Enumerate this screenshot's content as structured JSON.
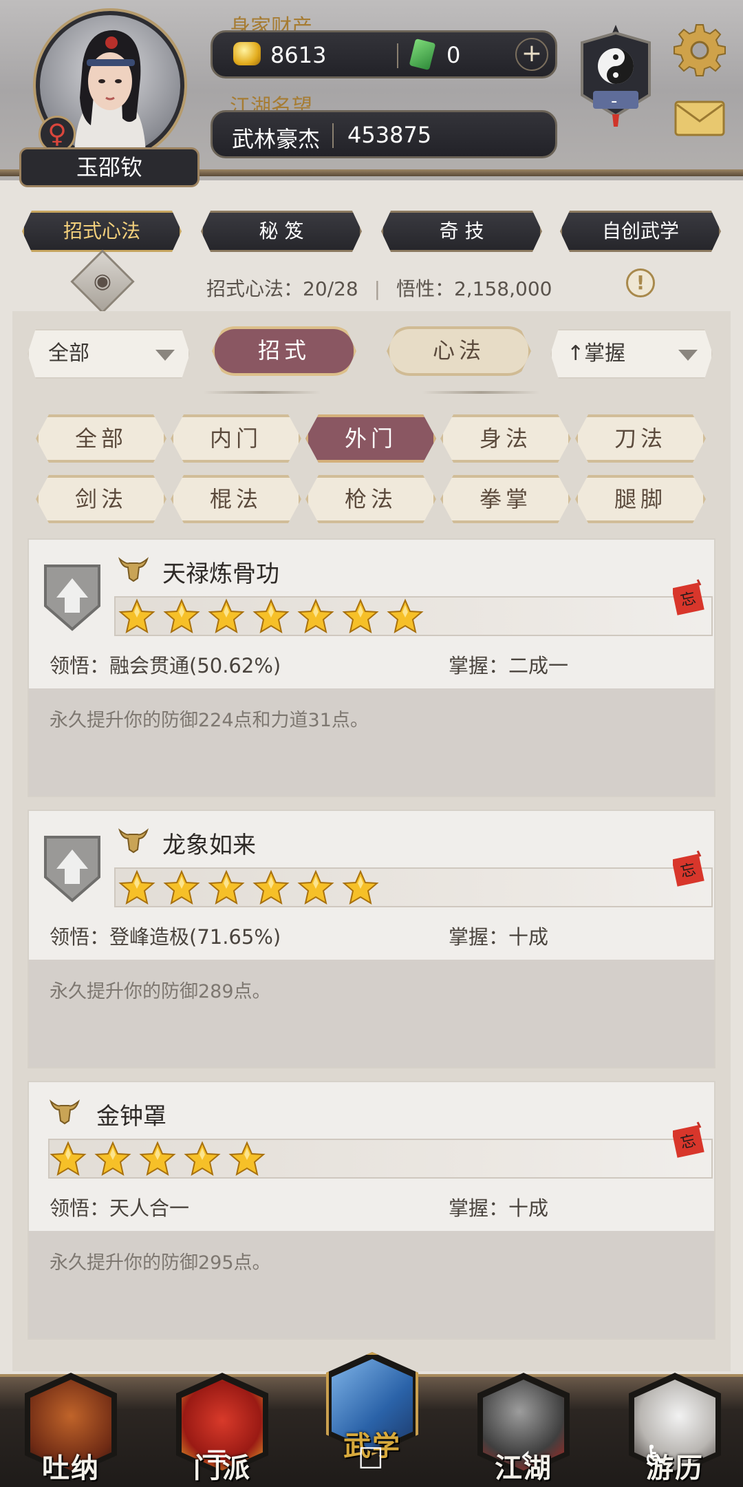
{
  "header": {
    "player_name": "玉邵钦",
    "gender_symbol": "♀",
    "wealth_label": "身家财产",
    "gold": "8613",
    "jade": "0",
    "add_symbol": "+",
    "reputation_label": "江湖名望",
    "reputation_title": "武林豪杰",
    "reputation_value": "453875",
    "faction_badge_text": "-",
    "icons": [
      "gear-icon",
      "mail-icon",
      "yin-yang-icon"
    ]
  },
  "top_tabs": [
    {
      "label": "招式心法",
      "active": true
    },
    {
      "label": "秘 笈",
      "active": false
    },
    {
      "label": "奇 技",
      "active": false
    },
    {
      "label": "自创武学",
      "active": false
    }
  ],
  "stats": {
    "moves": "招式心法：20/28",
    "comprehension": "悟性：2,158,000",
    "warn_symbol": "!"
  },
  "filters": {
    "left_dropdown": "全部",
    "right_dropdown": "掌握",
    "sort_arrow": "↑",
    "segments": [
      {
        "label": "招式",
        "active": true
      },
      {
        "label": "心法",
        "active": false
      }
    ]
  },
  "categories": [
    {
      "label": "全部",
      "active": false
    },
    {
      "label": "内门",
      "active": false
    },
    {
      "label": "外门",
      "active": true
    },
    {
      "label": "身法",
      "active": false
    },
    {
      "label": "刀法",
      "active": false
    },
    {
      "label": "剑法",
      "active": false
    },
    {
      "label": "棍法",
      "active": false
    },
    {
      "label": "枪法",
      "active": false
    },
    {
      "label": "拳掌",
      "active": false
    },
    {
      "label": "腿脚",
      "active": false
    }
  ],
  "skills": [
    {
      "name": "天禄炼骨功",
      "stars": 7,
      "has_upgrade_shield": true,
      "insight": "领悟：融会贯通(50.62%)",
      "mastery": "掌握：二成一",
      "description": "永久提升你的防御224点和力道31点。",
      "tag_text": "忘"
    },
    {
      "name": "龙象如来",
      "stars": 6,
      "has_upgrade_shield": true,
      "insight": "领悟：登峰造极(71.65%)",
      "mastery": "掌握：十成",
      "description": "永久提升你的防御289点。",
      "tag_text": "忘"
    },
    {
      "name": "金钟罩",
      "stars": 5,
      "has_upgrade_shield": false,
      "insight": "领悟：天人合一",
      "mastery": "掌握：十成",
      "description": "永久提升你的防御295点。",
      "tag_text": "忘"
    }
  ],
  "bottom_nav": [
    {
      "label": "吐纳",
      "active": false
    },
    {
      "label": "门派",
      "active": false
    },
    {
      "label": "武学",
      "active": true
    },
    {
      "label": "江湖",
      "active": false
    },
    {
      "label": "游历",
      "active": false
    }
  ],
  "system_nav": {
    "menu": "≡",
    "home": "□",
    "back": "‹",
    "accessibility": "♿"
  },
  "colors": {
    "accent_active": "#8a5762",
    "gold_text": "#a67c33",
    "nav_active": "#d7a93c",
    "star_fill": "#f6c028"
  }
}
